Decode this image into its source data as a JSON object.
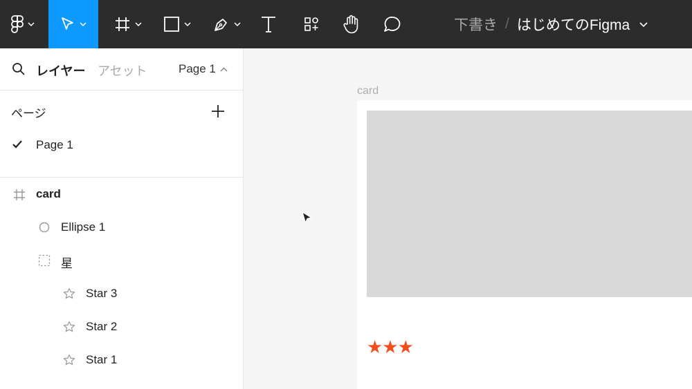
{
  "toolbar": {
    "file": {
      "draft": "下書き",
      "separator": "/",
      "name": "はじめてのFigma"
    }
  },
  "panel": {
    "tabs": {
      "layers": "レイヤー",
      "assets": "アセット",
      "current_page": "Page 1"
    },
    "pages": {
      "heading": "ページ",
      "items": [
        "Page 1"
      ]
    },
    "layers": [
      {
        "name": "card",
        "icon": "frame-icon"
      },
      {
        "name": "Ellipse 1",
        "icon": "ellipse-icon"
      },
      {
        "name": "星",
        "icon": "group-icon"
      },
      {
        "name": "Star 3",
        "icon": "star-outline-icon"
      },
      {
        "name": "Star 2",
        "icon": "star-outline-icon"
      },
      {
        "name": "Star 1",
        "icon": "star-outline-icon"
      }
    ]
  },
  "canvas": {
    "frame_label": "card",
    "stars": "★★★",
    "star_color": "#f24e1e",
    "placeholder_color": "#d9d9d9"
  },
  "colors": {
    "toolbar_bg": "#2c2c2c",
    "accent": "#0d99ff"
  }
}
